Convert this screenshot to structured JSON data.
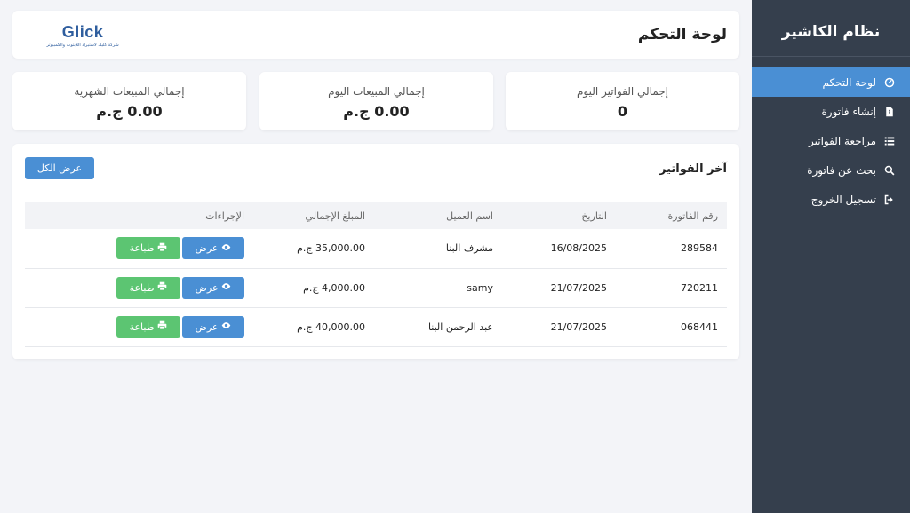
{
  "sidebar": {
    "title": "نظام الكاشير",
    "items": [
      {
        "label": "لوحة التحكم",
        "icon": "gauge-icon",
        "active": true
      },
      {
        "label": "إنشاء فاتورة",
        "icon": "file-invoice-icon"
      },
      {
        "label": "مراجعة الفواتير",
        "icon": "list-icon"
      },
      {
        "label": "بحث عن فاتورة",
        "icon": "search-icon"
      },
      {
        "label": "تسجيل الخروج",
        "icon": "sign-out-icon"
      }
    ]
  },
  "header": {
    "title": "لوحة التحكم",
    "logo_text": "Glick",
    "logo_tagline": "شركة كليك لاستيراد اللابتوب والكمبيوتر"
  },
  "stats": [
    {
      "label": "إجمالي الفواتير اليوم",
      "value": "0"
    },
    {
      "label": "إجمالي المبيعات اليوم",
      "value": "0.00 ج.م"
    },
    {
      "label": "إجمالي المبيعات الشهرية",
      "value": "0.00 ج.م"
    }
  ],
  "invoices": {
    "title": "آخر الفواتير",
    "view_all_label": "عرض الكل",
    "columns": [
      "رقم الفاتورة",
      "التاريخ",
      "اسم العميل",
      "المبلغ الإجمالي",
      "الإجراءات"
    ],
    "rows": [
      {
        "number": "289584",
        "date": "16/08/2025",
        "customer": "مشرف البنا",
        "amount": "35,000.00 ج.م"
      },
      {
        "number": "720211",
        "date": "21/07/2025",
        "customer": "samy",
        "amount": "4,000.00 ج.م"
      },
      {
        "number": "068441",
        "date": "21/07/2025",
        "customer": "عبد الرحمن البنا",
        "amount": "40,000.00 ج.م"
      }
    ],
    "view_label": "عرض",
    "print_label": "طباعة"
  },
  "colors": {
    "sidebar_bg": "#353f4d",
    "accent": "#4a8fd4",
    "print_green": "#5cc572",
    "page_bg": "#f3f4f8"
  }
}
